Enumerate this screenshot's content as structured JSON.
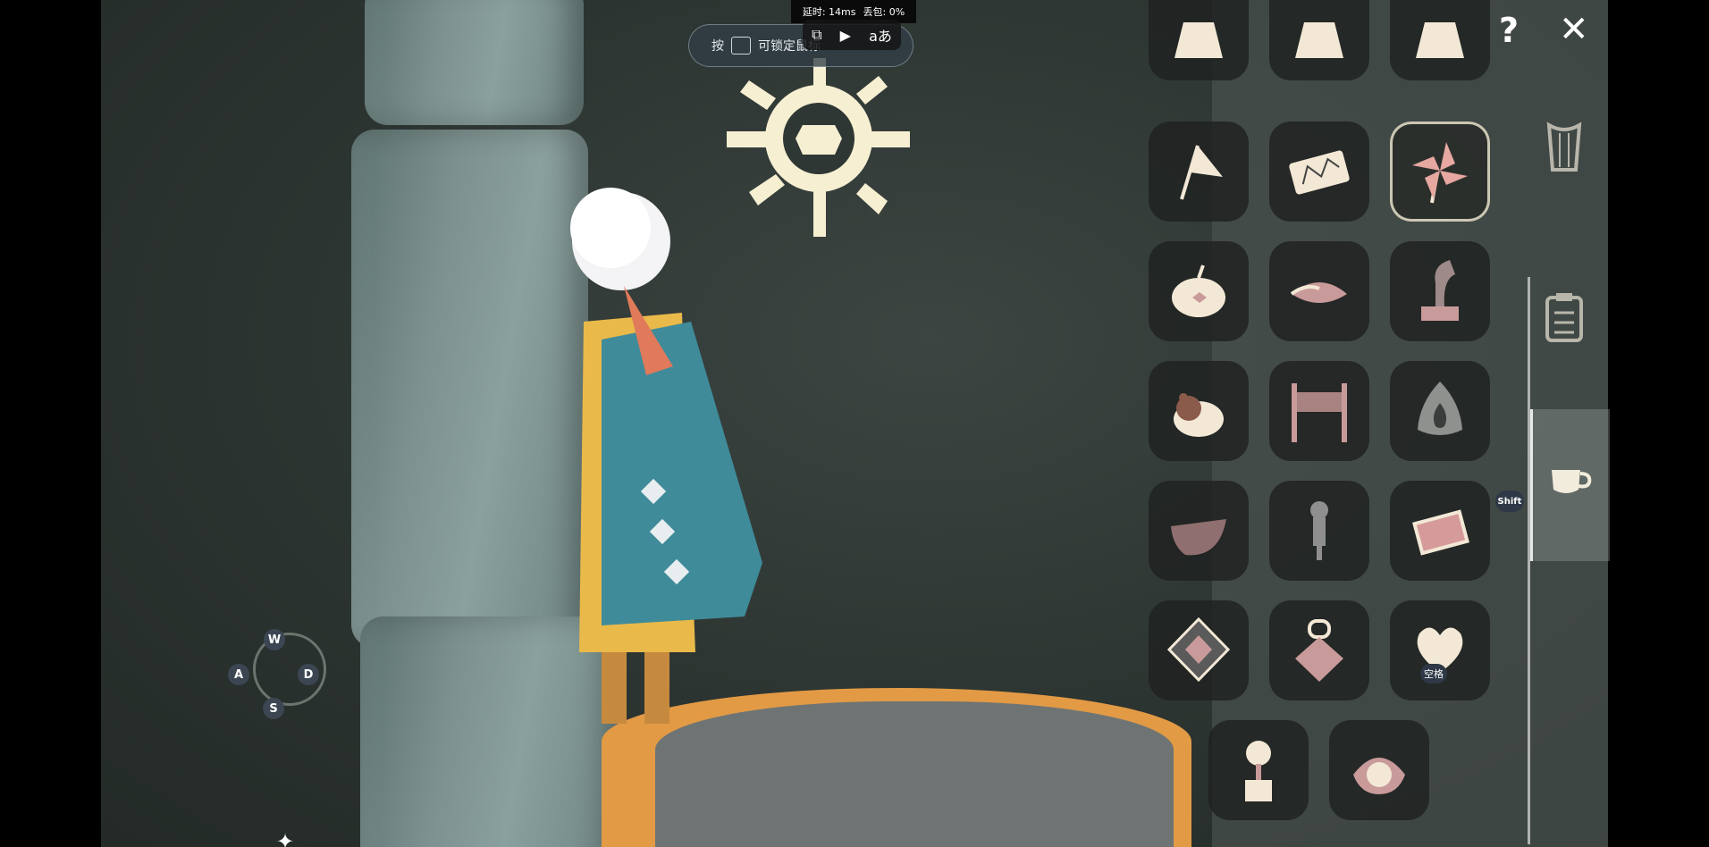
{
  "status_bar": {
    "latency_label": "延时:",
    "latency_value": "14ms",
    "loss_label": "丢包:",
    "loss_value": "0%"
  },
  "tip": {
    "prefix": "按",
    "text": "可锁定鼠标"
  },
  "controls": {
    "up": "W",
    "left": "A",
    "right": "D",
    "down": "S"
  },
  "badges": {
    "shift": "Shift",
    "space": "空格"
  },
  "panel": {
    "help_icon": "question-icon",
    "close_icon": "close-icon",
    "tabs": [
      {
        "name": "harp-tab",
        "icon": "harp-icon",
        "active": false
      },
      {
        "name": "clipboard-tab",
        "icon": "clipboard-icon",
        "active": false
      },
      {
        "name": "teacup-tab",
        "icon": "teacup-icon",
        "active": true
      }
    ],
    "items": [
      {
        "icon": "tent-icon",
        "selected": false
      },
      {
        "icon": "tent-icon",
        "selected": false
      },
      {
        "icon": "tent-icon",
        "selected": false
      },
      {
        "icon": "flag-icon",
        "selected": false
      },
      {
        "icon": "constellation-mat-icon",
        "selected": false
      },
      {
        "icon": "pinwheel-icon",
        "selected": true
      },
      {
        "icon": "pumpkin-icon",
        "selected": false
      },
      {
        "icon": "cushion-icon",
        "selected": false
      },
      {
        "icon": "gramophone-icon",
        "selected": false
      },
      {
        "icon": "bear-icon",
        "selected": false
      },
      {
        "icon": "banner-gate-icon",
        "selected": false
      },
      {
        "icon": "flame-stone-icon",
        "selected": false
      },
      {
        "icon": "hammock-icon",
        "selected": false
      },
      {
        "icon": "training-dummy-icon",
        "selected": false
      },
      {
        "icon": "rug-icon",
        "selected": false
      },
      {
        "icon": "diamond-lamp-icon",
        "selected": false
      },
      {
        "icon": "lantern-icon",
        "selected": false
      },
      {
        "icon": "heart-balloon-icon",
        "selected": false
      },
      {
        "icon": "rose-pot-icon",
        "selected": false
      },
      {
        "icon": "clam-pearl-icon",
        "selected": false
      }
    ]
  },
  "colors": {
    "item_cream": "#f2e8d5",
    "item_pink": "#c99a9a",
    "panel_bg": "#4e5654",
    "sun_glyph": "#f6efd2",
    "cape_blue": "#3f8b9a",
    "robe_yellow": "#e9b94a"
  }
}
